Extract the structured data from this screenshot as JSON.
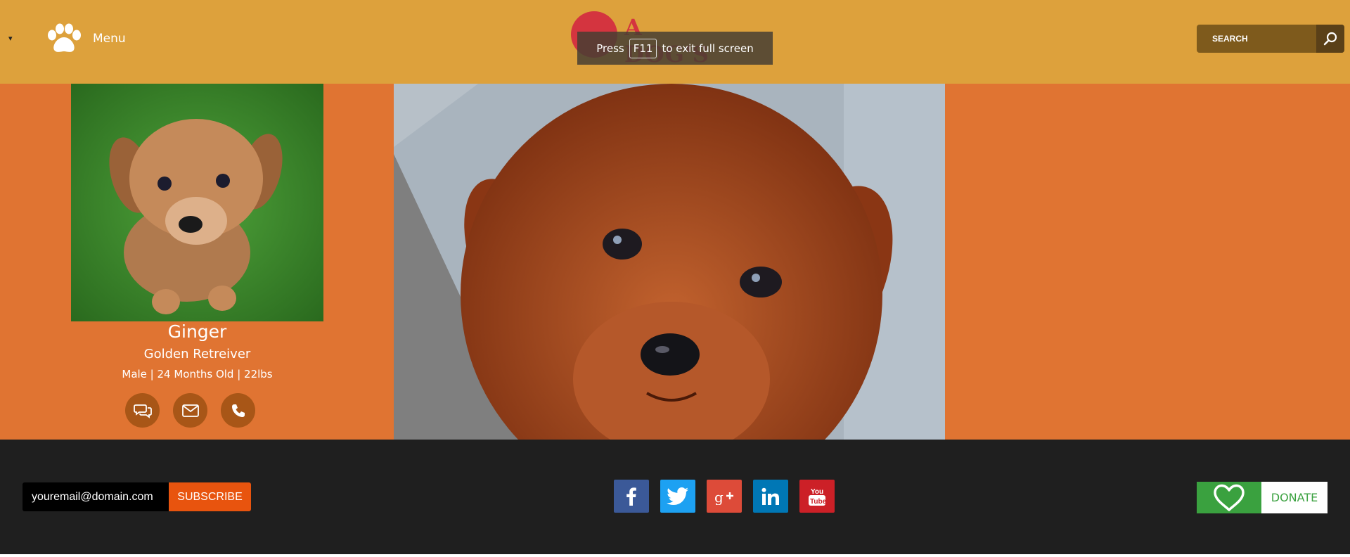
{
  "header": {
    "dropdown_caret": "▾",
    "menu_label": "Menu",
    "logo_text": "A DOG'S",
    "fullscreen_notice": {
      "before": "Press",
      "key": "F11",
      "after": "to exit full screen"
    },
    "search_placeholder": "SEARCH"
  },
  "profile": {
    "name": "Ginger",
    "breed": "Golden Retreiver",
    "details": "Male | 24 Months Old | 22lbs",
    "contact_icons": [
      "chat-icon",
      "email-icon",
      "phone-icon"
    ]
  },
  "footer": {
    "email_value": "youremail@domain.com",
    "subscribe_label": "SUBSCRIBE",
    "social": [
      {
        "name": "facebook",
        "color": "#3B5998"
      },
      {
        "name": "twitter",
        "color": "#1DA1F2"
      },
      {
        "name": "google-plus",
        "color": "#DD4B39"
      },
      {
        "name": "linkedin",
        "color": "#0077B5"
      },
      {
        "name": "youtube",
        "color": "#CC2027"
      }
    ],
    "donate_label": "DONATE"
  },
  "colors": {
    "header_bg": "#DDA13C",
    "band_bg": "#E07432",
    "footer_bg": "#1F1F1F",
    "accent_orange": "#E8540E",
    "donate_green": "#3AA13F"
  }
}
